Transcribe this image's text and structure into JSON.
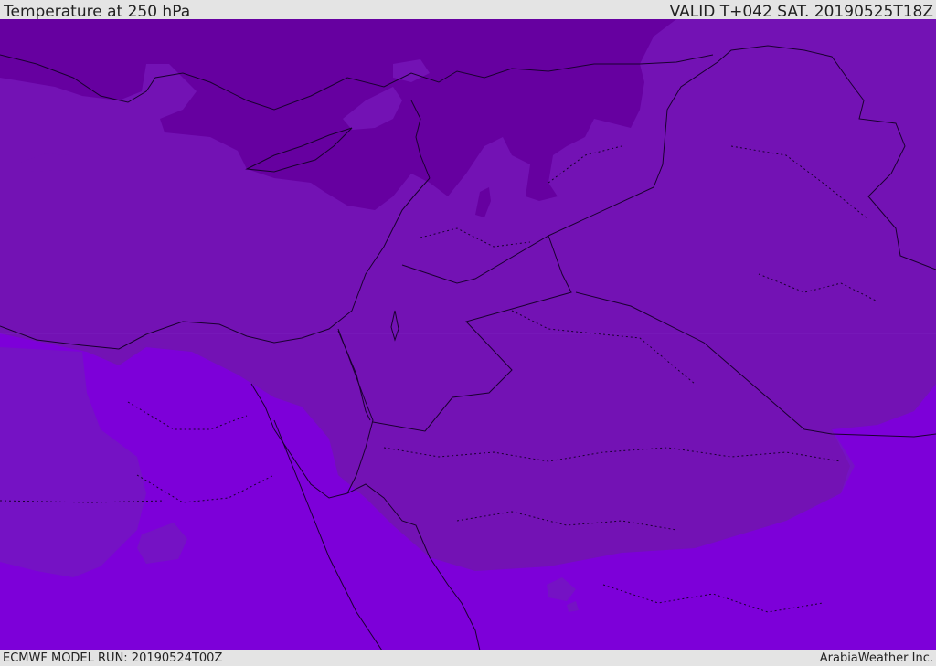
{
  "header": {
    "title": "Temperature at 250 hPa",
    "valid_time": "VALID T+042 SAT. 20190525T18Z"
  },
  "footer": {
    "model_run": "ECMWF MODEL RUN: 20190524T00Z",
    "brand": "ArabiaWeather Inc."
  },
  "colors": {
    "band_coldest": "#6600a0",
    "band_cold": "#7312b4",
    "band_mid": "#7a0fc8",
    "band_warm": "#7d00d9",
    "border": "#1a0030"
  }
}
